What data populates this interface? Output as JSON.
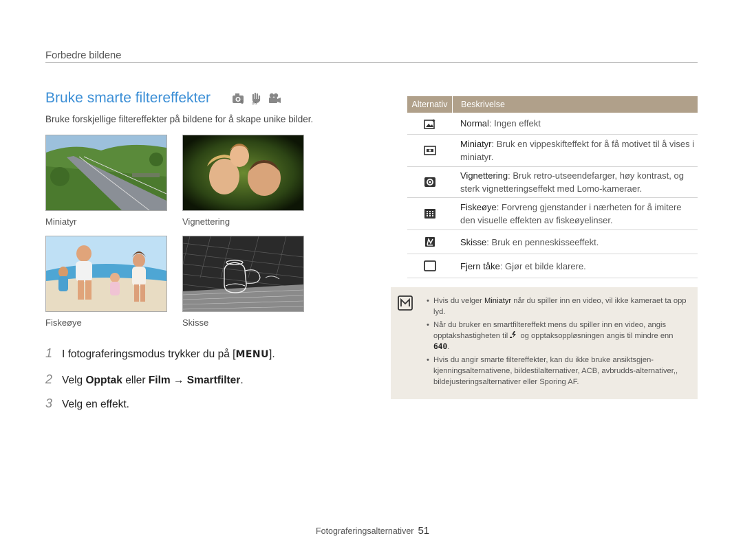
{
  "section_title": "Forbedre bildene",
  "heading": "Bruke smarte filtereffekter",
  "mode_icons": [
    "smart-auto-camera-icon",
    "dual-is-hand-icon",
    "movie-camera-icon"
  ],
  "intro": "Bruke forskjellige filtereffekter på bildene for å skape unike bilder.",
  "photos": [
    {
      "caption": "Miniatyr"
    },
    {
      "caption": "Vignettering"
    },
    {
      "caption": "Fiskeøye"
    },
    {
      "caption": "Skisse"
    }
  ],
  "steps": [
    {
      "num": "1",
      "pre": "I fotograferingsmodus trykker du på [",
      "key": "MENU",
      "post": "]."
    },
    {
      "num": "2",
      "pre": "Velg ",
      "b1": "Opptak",
      "mid": " eller ",
      "b2": "Film",
      "arrow": " → ",
      "b3": "Smartfilter",
      "post": "."
    },
    {
      "num": "3",
      "text": "Velg en effekt."
    }
  ],
  "table": {
    "headers": [
      "Alternativ",
      "Beskrivelse"
    ],
    "rows": [
      {
        "icon": "normal-filter-icon",
        "term": "Normal",
        "desc": ": Ingen effekt"
      },
      {
        "icon": "miniature-filter-icon",
        "term": "Miniatyr",
        "desc": ": Bruk en vippeskifteffekt for å få motivet til å vises i miniatyr."
      },
      {
        "icon": "vignetting-filter-icon",
        "term": "Vignettering",
        "desc": ": Bruk retro-utseendefarger, høy kontrast, og sterk vignetteringseffekt med Lomo-kameraer."
      },
      {
        "icon": "fisheye-filter-icon",
        "term": "Fiskeøye",
        "desc": ": Forvreng gjenstander i nærheten for å imitere den visuelle effekten av fiskeøyelinser."
      },
      {
        "icon": "sketch-filter-icon",
        "term": "Skisse",
        "desc": ": Bruk en penneskisseeffekt."
      },
      {
        "icon": "defog-filter-icon",
        "term": "Fjern tåke",
        "desc": ": Gjør et bilde klarere."
      }
    ]
  },
  "note": {
    "icon": "note-icon",
    "items": [
      {
        "a": "Hvis du velger ",
        "b": "Miniatyr",
        "c": " når du spiller inn en video, vil ikke kameraet ta opp lyd."
      },
      {
        "a": "Når du bruker en smartfiltereffekt mens du spiller inn en video, angis opptakshastigheten til ",
        "icon": "slow-frame-icon",
        "c": " og opptaksoppløsningen angis til mindre enn ",
        "res": "640",
        "d": "."
      },
      {
        "a": "Hvis du angir smarte filtereffekter, kan du ikke bruke ansiktsgjen-kjenningsalternativene, bildestilalternativer, ACB, avbrudds-alternativer,, bildejusteringsalternativer eller Sporing AF."
      }
    ]
  },
  "footer": {
    "label": "Fotograferingsalternativer",
    "page": "51"
  }
}
